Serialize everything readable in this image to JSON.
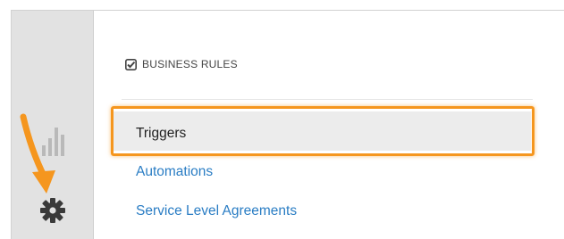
{
  "sidebar": {
    "icons": [
      {
        "name": "reports-icon"
      },
      {
        "name": "gear-icon"
      }
    ]
  },
  "panel": {
    "section_title": "BUSINESS RULES",
    "section_icon": "check-square-icon",
    "items": [
      {
        "label": "Triggers",
        "selected": true
      },
      {
        "label": "Automations",
        "selected": false
      },
      {
        "label": "Service Level Agreements",
        "selected": false
      }
    ]
  },
  "annotation": {
    "highlight_color": "#f5961e",
    "arrow_color": "#f5961e"
  },
  "colors": {
    "link": "#2a7dc4",
    "rail": "#e2e2e2",
    "selected_row": "#ececec"
  }
}
